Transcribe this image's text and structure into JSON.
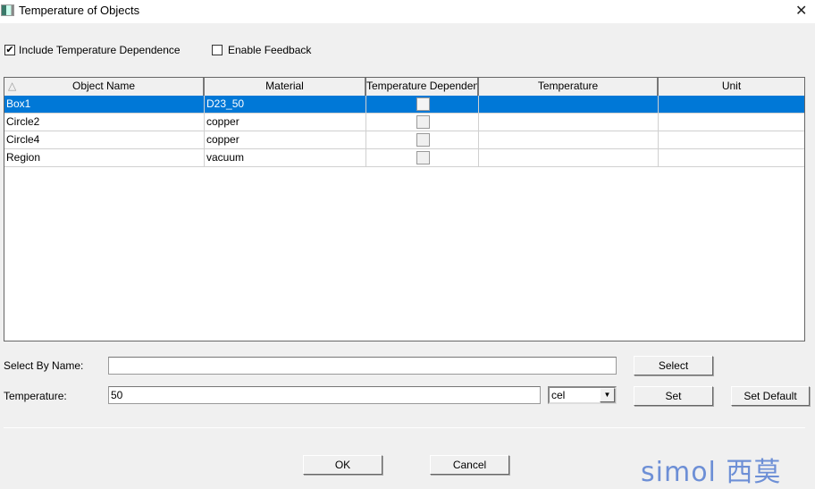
{
  "window": {
    "title": "Temperature of Objects",
    "close": "✕"
  },
  "options": {
    "include_temp": {
      "label": "Include Temperature Dependence",
      "checked": true
    },
    "feedback": {
      "label": "Enable Feedback",
      "checked": false
    }
  },
  "table": {
    "sort_indicator": "△",
    "columns": [
      "Object Name",
      "Material",
      "Temperature Dependent",
      "Temperature",
      "Unit"
    ],
    "rows": [
      {
        "name": "Box1",
        "material": "D23_50",
        "temp_dependent": false,
        "temperature": "",
        "unit": "",
        "selected": true
      },
      {
        "name": "Circle2",
        "material": "copper",
        "temp_dependent": false,
        "temperature": "",
        "unit": "",
        "selected": false
      },
      {
        "name": "Circle4",
        "material": "copper",
        "temp_dependent": false,
        "temperature": "",
        "unit": "",
        "selected": false
      },
      {
        "name": "Region",
        "material": "vacuum",
        "temp_dependent": false,
        "temperature": "",
        "unit": "",
        "selected": false
      }
    ]
  },
  "select_by_name": {
    "label": "Select By Name:",
    "value": "",
    "button": "Select"
  },
  "temperature": {
    "label": "Temperature:",
    "value": "50",
    "unit": "cel",
    "set": "Set",
    "set_default": "Set Default"
  },
  "footer": {
    "ok": "OK",
    "cancel": "Cancel"
  },
  "watermark": {
    "text": "simol 西莫",
    "color": "#6d8fd6"
  }
}
